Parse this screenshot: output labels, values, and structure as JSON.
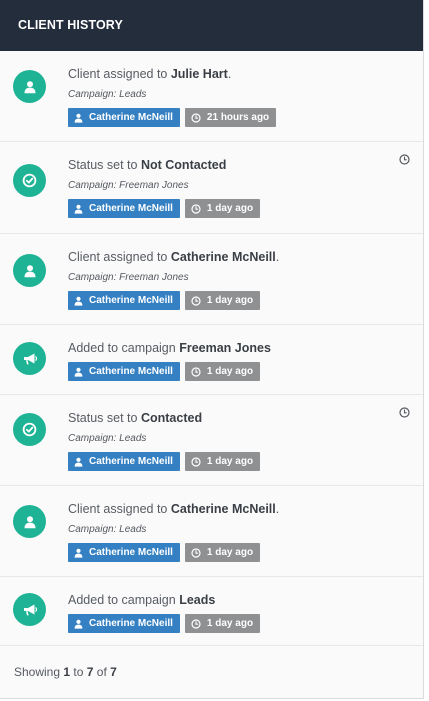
{
  "header": {
    "title": "CLIENT HISTORY"
  },
  "items": [
    {
      "type": "user",
      "prefix": "Client assigned to ",
      "bold": "Julie Hart",
      "suffix": ".",
      "campaign": "Campaign: Leads",
      "user": "Catherine McNeill",
      "time": "21 hours ago",
      "clock": false
    },
    {
      "type": "check",
      "prefix": "Status set to ",
      "bold": "Not Contacted",
      "suffix": "",
      "campaign": "Campaign: Freeman Jones",
      "user": "Catherine McNeill",
      "time": "1 day ago",
      "clock": true
    },
    {
      "type": "user",
      "prefix": "Client assigned to ",
      "bold": "Catherine McNeill",
      "suffix": ".",
      "campaign": "Campaign: Freeman Jones",
      "user": "Catherine McNeill",
      "time": "1 day ago",
      "clock": false
    },
    {
      "type": "megaphone",
      "prefix": "Added to campaign ",
      "bold": "Freeman Jones",
      "suffix": "",
      "campaign": "",
      "user": "Catherine McNeill",
      "time": "1 day ago",
      "clock": false
    },
    {
      "type": "check",
      "prefix": "Status set to ",
      "bold": "Contacted",
      "suffix": "",
      "campaign": "Campaign: Leads",
      "user": "Catherine McNeill",
      "time": "1 day ago",
      "clock": true
    },
    {
      "type": "user",
      "prefix": "Client assigned to ",
      "bold": "Catherine McNeill",
      "suffix": ".",
      "campaign": "Campaign: Leads",
      "user": "Catherine McNeill",
      "time": "1 day ago",
      "clock": false
    },
    {
      "type": "megaphone",
      "prefix": "Added to campaign ",
      "bold": "Leads",
      "suffix": "",
      "campaign": "",
      "user": "Catherine McNeill",
      "time": "1 day ago",
      "clock": false
    }
  ],
  "footer": {
    "showing": "Showing ",
    "from": "1",
    "to_word": " to ",
    "to": "7",
    "of_word": " of ",
    "total": "7"
  },
  "colors": {
    "header_bg": "#242d3c",
    "icon_circle": "#1db394",
    "user_tag": "#3580c2",
    "time_tag": "#8e9092"
  },
  "icons": {
    "user": "user-icon",
    "check": "check-circle-icon",
    "megaphone": "megaphone-icon",
    "clock": "clock-icon"
  }
}
